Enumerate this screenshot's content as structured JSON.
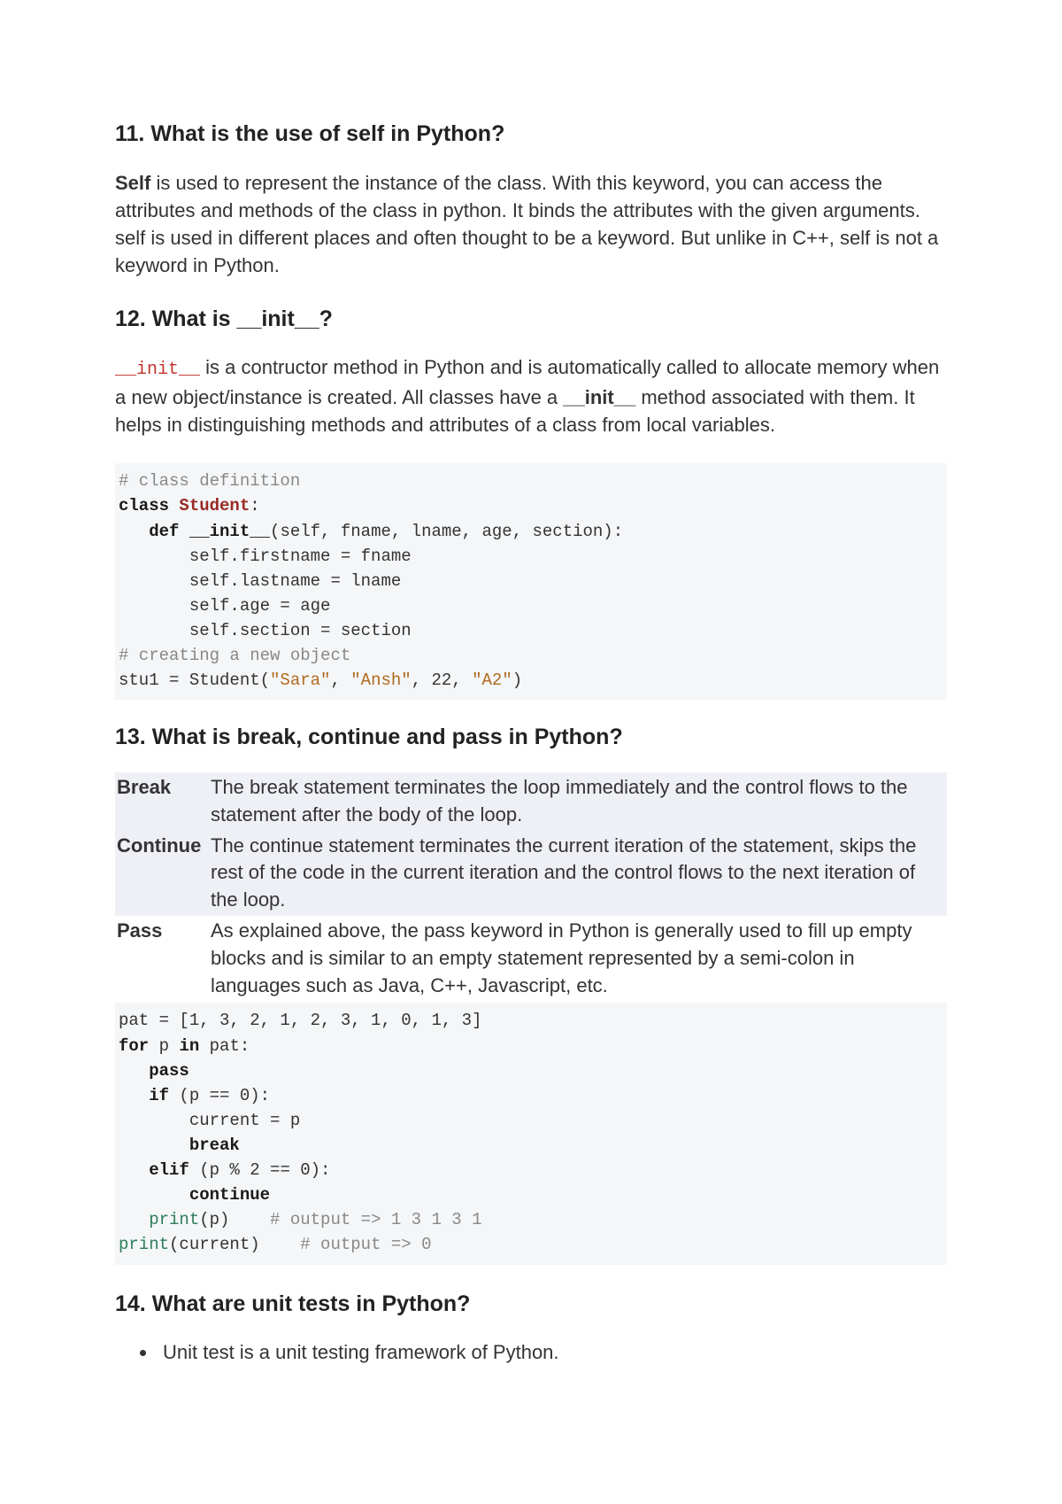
{
  "q11": {
    "heading": "11. What is the use of self in Python?",
    "para_bold": "Self",
    "para_rest": " is used to represent the instance of the class. With this keyword, you can access the attributes and methods of the class in python. It binds the attributes with the given arguments. self is used in different places and often thought to be a keyword. But unlike in C++, self is not a keyword in Python."
  },
  "q12": {
    "heading": "12. What is __init__?",
    "inline_code": "__init__",
    "para_a": " is a contructor method in Python and is automatically called to allocate memory when a new object/instance is created. All classes have a ",
    "para_b_bold": "__init__",
    "para_c": " method associated with them. It helps in distinguishing methods and attributes of a class from local variables.",
    "code": {
      "c1": "# class definition",
      "c2a": "class",
      "c2b": " Student",
      "c2c": ":",
      "c3a": "   def",
      "c3b": " __init__",
      "c3c": "(self, fname, lname, age, section):",
      "c4": "       self.firstname = fname",
      "c5": "       self.lastname = lname",
      "c6": "       self.age = age",
      "c7": "       self.section = section",
      "c8": "# creating a new object",
      "c9a": "stu1 = Student(",
      "c9b": "\"Sara\"",
      "c9c": ", ",
      "c9d": "\"Ansh\"",
      "c9e": ", 22, ",
      "c9f": "\"A2\"",
      "c9g": ")"
    }
  },
  "q13": {
    "heading": "13. What is break, continue and pass in Python?",
    "rows": [
      {
        "term": "Break",
        "desc": "The break statement terminates the loop immediately and the control flows to the statement after the body of the loop."
      },
      {
        "term": "Continue",
        "desc": "The continue statement terminates the current iteration of the statement, skips the rest of the code in the current iteration and the control flows to the next iteration of the loop."
      },
      {
        "term": "Pass",
        "desc": "As explained above, the pass keyword in Python is generally used to fill up empty blocks and is similar to an empty statement represented by a semi-colon in languages such as Java, C++, Javascript, etc."
      }
    ],
    "code": {
      "l1": "pat = [1, 3, 2, 1, 2, 3, 1, 0, 1, 3]",
      "l2a": "for",
      "l2b": " p ",
      "l2c": "in",
      "l2d": " pat:",
      "l3": "   pass",
      "l4a": "   if",
      "l4b": " (p == 0):",
      "l5": "       current = p",
      "l6": "       break",
      "l7a": "   elif",
      "l7b": " (p % 2 == 0):",
      "l8": "       continue",
      "l9a": "   print",
      "l9b": "(p)    ",
      "l9c": "# output => 1 3 1 3 1",
      "l10a": "print",
      "l10b": "(current)    ",
      "l10c": "# output => 0"
    }
  },
  "q14": {
    "heading": "14. What are unit tests in Python?",
    "bullet1": "Unit test is a unit testing framework of Python."
  }
}
